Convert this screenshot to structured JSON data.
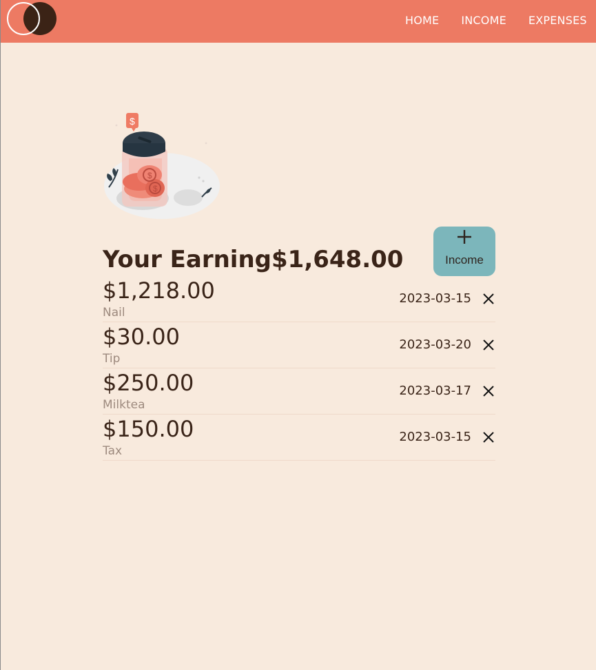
{
  "navbar": {
    "links": [
      "HOME",
      "INCOME",
      "EXPENSES"
    ]
  },
  "summary": {
    "title": "Your Earning$1,648.00",
    "add_button_label": "Income",
    "add_icon": "plus-icon"
  },
  "income_items": [
    {
      "amount": "$1,218.00",
      "source": "Nail",
      "date": "2023-03-15"
    },
    {
      "amount": "$30.00",
      "source": "Tip",
      "date": "2023-03-20"
    },
    {
      "amount": "$250.00",
      "source": "Milktea",
      "date": "2023-03-17"
    },
    {
      "amount": "$150.00",
      "source": "Tax",
      "date": "2023-03-15"
    }
  ],
  "icons": {
    "logo": "logo-icon",
    "delete": "close-icon",
    "illustration": "coin-jar-illustration"
  },
  "colors": {
    "navbar": "#ed7a63",
    "background": "#f8eadd",
    "button": "#7cb6bb",
    "text": "#3a2418",
    "muted_text": "#9d8a7e"
  }
}
